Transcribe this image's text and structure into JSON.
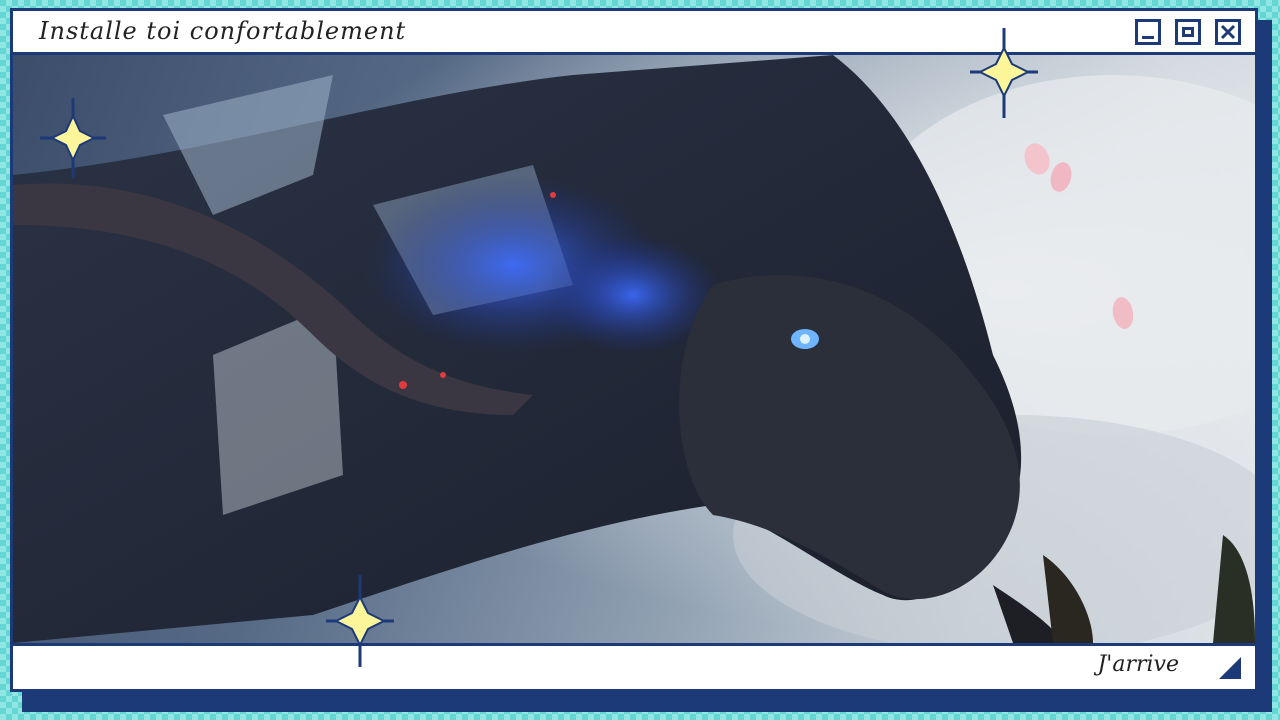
{
  "window": {
    "title": "Installe toi confortablement",
    "status_text": "J'arrive",
    "controls": {
      "minimize_icon": "minimize-icon",
      "maximize_icon": "maximize-icon",
      "close_icon": "close-icon"
    }
  },
  "scene": {
    "subject": "dragon-illustration"
  },
  "colors": {
    "frame": "#1d3a78",
    "background_checker": "#63d6d4",
    "sparkle_fill": "#fdf59a"
  }
}
